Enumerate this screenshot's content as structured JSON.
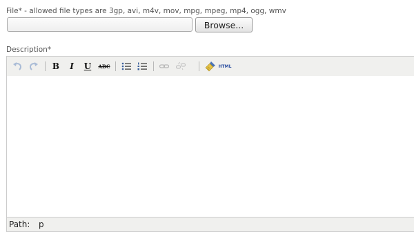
{
  "file_field": {
    "label": "File* - allowed file types are 3gp, avi, m4v, mov, mpg, mpeg, mp4, ogg, wmv",
    "value": "",
    "browse_label": "Browse..."
  },
  "description": {
    "label": "Description*",
    "content": ""
  },
  "toolbar": {
    "bold_label": "B",
    "italic_label": "I",
    "underline_label": "U",
    "strikethrough_label": "ABC",
    "html_label": "HTML"
  },
  "statusbar": {
    "path_label": "Path:",
    "path_value": "p"
  },
  "colors": {
    "toolbar_bg": "#f0f0ee",
    "border": "#cccccc",
    "disabled_icon": "#a9bbd6",
    "html_text": "#2b4ea0"
  },
  "icons": [
    "undo-icon",
    "redo-icon",
    "bullet-list-icon",
    "numbered-list-icon",
    "link-icon",
    "unlink-icon",
    "cleanup-icon"
  ]
}
